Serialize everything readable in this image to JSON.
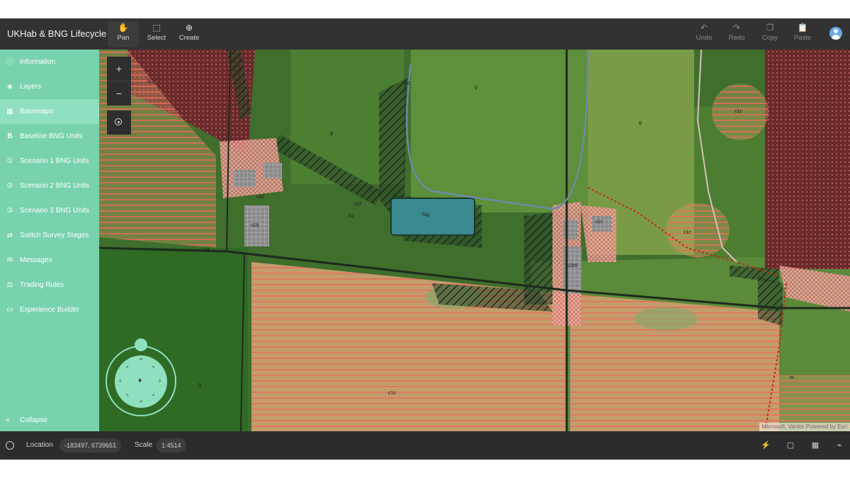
{
  "app": {
    "title": "UKHab & BNG Lifecycle"
  },
  "toolbar": {
    "left": [
      {
        "label": "Pan",
        "icon": "pan-hand-icon"
      },
      {
        "label": "Select",
        "icon": "select-box-icon"
      },
      {
        "label": "Create",
        "icon": "create-plus-icon"
      }
    ],
    "right": [
      {
        "label": "Undo",
        "icon": "undo-icon"
      },
      {
        "label": "Redo",
        "icon": "redo-icon"
      },
      {
        "label": "Copy",
        "icon": "copy-icon"
      },
      {
        "label": "Paste",
        "icon": "paste-icon"
      }
    ]
  },
  "sidebar": {
    "items": [
      {
        "label": "Information",
        "icon": "info-icon"
      },
      {
        "label": "Layers",
        "icon": "layers-icon"
      },
      {
        "label": "Basemaps",
        "icon": "basemap-grid-icon"
      },
      {
        "label": "Baseline BNG Units",
        "icon": "b-letter-icon"
      },
      {
        "label": "Scenario 1 BNG Units",
        "icon": "scenario-1-icon"
      },
      {
        "label": "Scenario 2 BNG Units",
        "icon": "scenario-2-icon"
      },
      {
        "label": "Scenario 3 BNG Units",
        "icon": "scenario-3-icon"
      },
      {
        "label": "Switch Survey Stages",
        "icon": "switch-arrows-icon"
      },
      {
        "label": "Messages",
        "icon": "messages-icon"
      },
      {
        "label": "Trading Rules",
        "icon": "trading-rules-icon"
      },
      {
        "label": "Experience Builder",
        "icon": "monitor-icon"
      }
    ],
    "active_index": 2,
    "collapse_label": "Collapse"
  },
  "map": {
    "attribution": "Microsoft, Vantor   Powered by Esri",
    "labels": {
      "c1c": "c1c",
      "w": "w",
      "g": "g",
      "u1b": "u1b",
      "u1f": "u1f",
      "w1": "w1",
      "w2": "w2",
      "h3": "h3",
      "h2": "h2",
      "f1g": "f1g",
      "u1b5": "u1b5",
      "u1k": "u1k",
      "u1c": "u1c"
    }
  },
  "status": {
    "location_label": "Location",
    "location_value": "-183497, 6739651",
    "scale_label": "Scale",
    "scale_value": "1:4514"
  },
  "colors": {
    "sidebar": "#78d3ad",
    "sidebar_active": "#8ee0bf",
    "topbar": "#323232",
    "statusbar": "#2c2c2c"
  }
}
